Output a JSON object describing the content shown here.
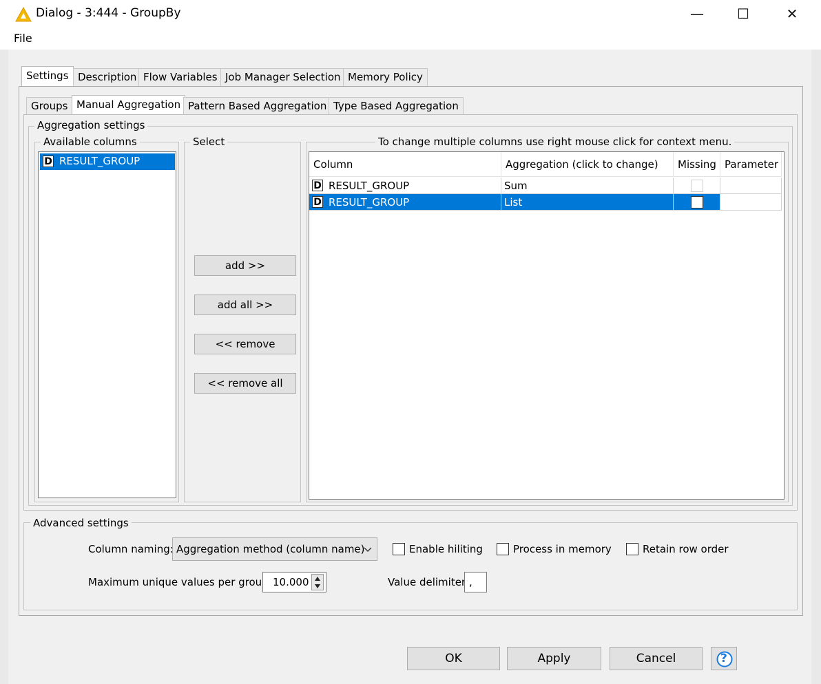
{
  "window": {
    "title": "Dialog - 3:444 - GroupBy",
    "minimize": "—",
    "maximize": "☐",
    "close": "✕"
  },
  "menu": {
    "file": "File"
  },
  "top_tabs": [
    {
      "label": "Settings",
      "active": true
    },
    {
      "label": "Description",
      "active": false
    },
    {
      "label": "Flow Variables",
      "active": false
    },
    {
      "label": "Job Manager Selection",
      "active": false
    },
    {
      "label": "Memory Policy",
      "active": false
    }
  ],
  "sub_tabs": [
    {
      "label": "Groups",
      "active": false
    },
    {
      "label": "Manual Aggregation",
      "active": true
    },
    {
      "label": "Pattern Based Aggregation",
      "active": false
    },
    {
      "label": "Type Based Aggregation",
      "active": false
    }
  ],
  "aggregation": {
    "group_title": "Aggregation settings",
    "available_title": "Available columns",
    "available_columns": [
      {
        "type": "D",
        "name": "RESULT_GROUP",
        "selected": true
      }
    ],
    "select_title": "Select",
    "buttons": {
      "add": "add >>",
      "add_all": "add all >>",
      "remove": "<< remove",
      "remove_all": "<< remove all"
    },
    "table_hint": "To change multiple columns use right mouse click for context menu.",
    "table_headers": {
      "column": "Column",
      "aggregation": "Aggregation (click to change)",
      "missing": "Missing",
      "parameter": "Parameter"
    },
    "rows": [
      {
        "type": "D",
        "column": "RESULT_GROUP",
        "aggregation": "Sum",
        "missing": false,
        "selected": false
      },
      {
        "type": "D",
        "column": "RESULT_GROUP",
        "aggregation": "List",
        "missing": false,
        "selected": true
      }
    ]
  },
  "advanced": {
    "title": "Advanced settings",
    "column_naming_label": "Column naming:",
    "column_naming_value": "Aggregation method (column name)",
    "enable_hiliting": "Enable hiliting",
    "process_in_memory": "Process in memory",
    "retain_row_order": "Retain row order",
    "max_unique_label": "Maximum unique values per group",
    "max_unique_value": "10.000",
    "value_delimiter_label": "Value delimiter",
    "value_delimiter_value": ","
  },
  "footer": {
    "ok": "OK",
    "apply": "Apply",
    "cancel": "Cancel",
    "help": "?"
  },
  "colors": {
    "selection": "#0078d7",
    "help_icon": "#1a7be0"
  }
}
